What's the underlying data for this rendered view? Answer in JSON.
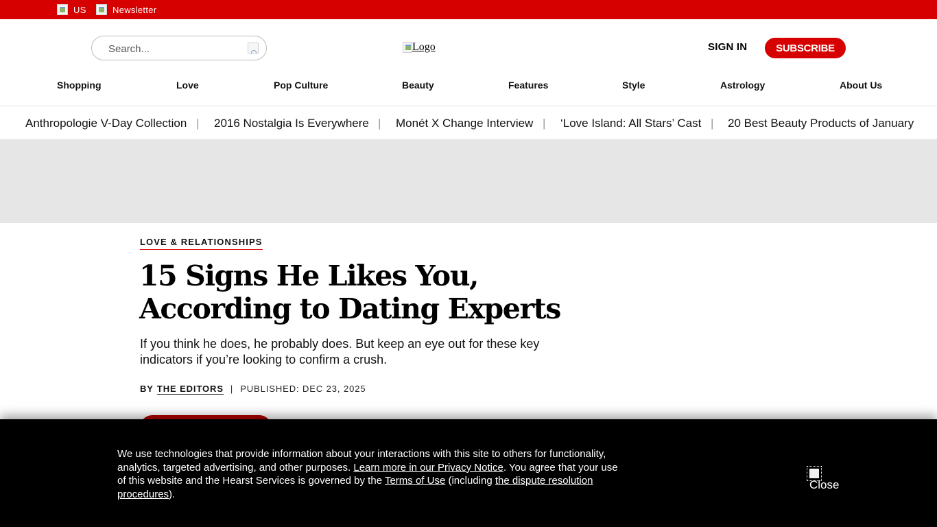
{
  "topbar": {
    "region": "US",
    "newsletter": "Newsletter"
  },
  "header": {
    "search_placeholder": "Search...",
    "logo_alt": "Logo",
    "sign_in": "SIGN IN",
    "subscribe": "SUBSCRIBE"
  },
  "nav": {
    "items": [
      "Shopping",
      "Love",
      "Pop Culture",
      "Beauty",
      "Features",
      "Style",
      "Astrology",
      "About Us"
    ]
  },
  "trending": {
    "items": [
      "Anthropologie V-Day Collection",
      "2016 Nostalgia Is Everywhere",
      "Monét X Change Interview",
      "‘Love Island: All Stars’ Cast",
      "20 Best Beauty Products of January"
    ],
    "separator": "|"
  },
  "article": {
    "category": "LOVE & RELATIONSHIPS",
    "headline": "15 Signs He Likes You, According to Dating Experts",
    "dek": "If you think he does, he probably does. But keep an eye out for these key indicators if you’re looking to confirm a crush.",
    "byline_prefix": "BY",
    "author": "THE EDITORS",
    "byline_sep": "|",
    "published": "PUBLISHED: DEC 23, 2025"
  },
  "cookie": {
    "text_1": "We use technologies that provide information about your interactions with this site to others for functionality, analytics, targeted advertising, and other purposes. ",
    "link_privacy": "Learn more in our Privacy Notice",
    "text_2": ". You agree that your use of this website and the Hearst Services is governed by the ",
    "link_terms": "Terms of Use",
    "text_3": " (including ",
    "link_dispute": "the dispute resolution procedures",
    "text_4": ").",
    "close_label": "Close"
  },
  "colors": {
    "brand_red": "#d60000",
    "ad_band": "#e6e6e6",
    "banner_bg": "#000000"
  },
  "icons": {
    "region": "broken-image-icon",
    "newsletter": "broken-image-icon",
    "search": "search-icon",
    "close": "close-icon"
  }
}
